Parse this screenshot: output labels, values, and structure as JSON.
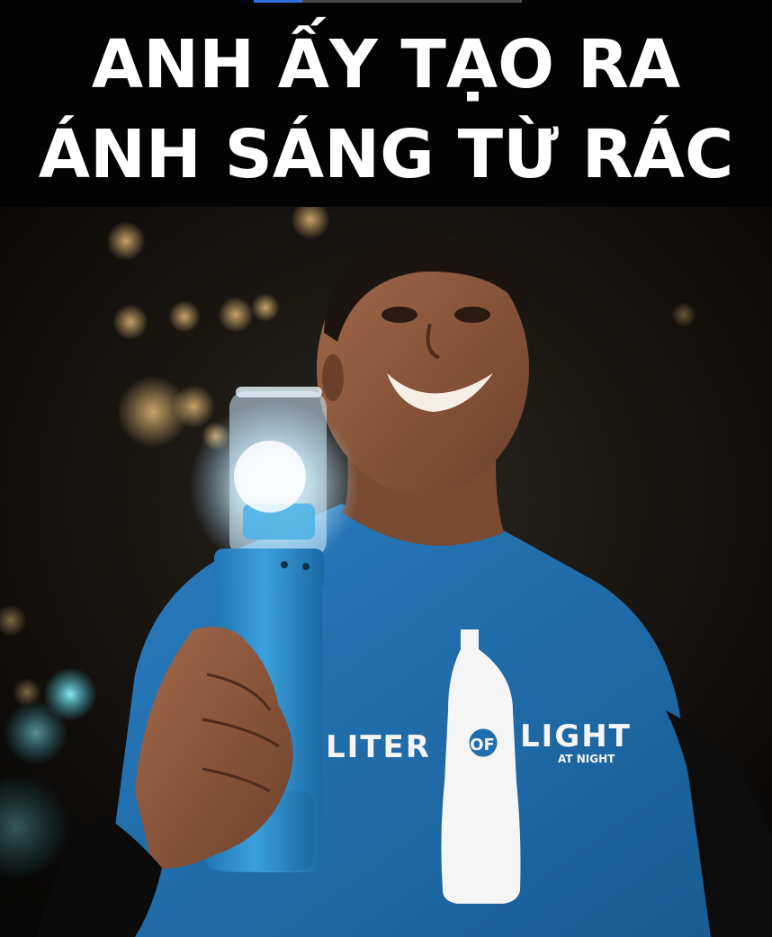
{
  "headline": {
    "line1": "ANH ẤY TẠO RA",
    "line2": "ÁNH SÁNG TỪ RÁC"
  },
  "video_progress": 0.18,
  "shirt": {
    "brand_left": "LITER",
    "brand_mid": "OF",
    "brand_right": "LIGHT",
    "brand_sub": "AT NIGHT"
  },
  "colors": {
    "shirt": "#1f6fae",
    "lamp": "#2d8fcb",
    "progress": "#2f6fe0"
  }
}
